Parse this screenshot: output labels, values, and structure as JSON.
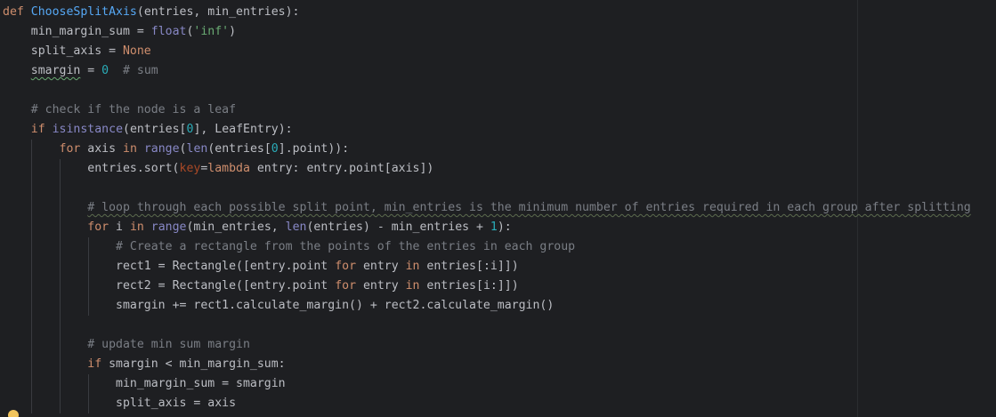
{
  "code": {
    "l1_def": "def",
    "l1_fn": "ChooseSplitAxis",
    "l1_rest": "(entries, min_entries):",
    "l2_a": "min_margin_sum = ",
    "l2_float": "float",
    "l2_p1": "(",
    "l2_str": "'inf'",
    "l2_p2": ")",
    "l3_a": "split_axis = ",
    "l3_none": "None",
    "l4_var": "smargin",
    "l4_a": " = ",
    "l4_num": "0",
    "l4_cm": "  # sum",
    "l6_cm": "# check if the node is a leaf",
    "l7_if": "if",
    "l7_isinstance": "isinstance",
    "l7_a": "(entries[",
    "l7_num": "0",
    "l7_b": "], LeafEntry):",
    "l8_for": "for",
    "l8_a": " axis ",
    "l8_in": "in",
    "l8_range": "range",
    "l8_p": "(",
    "l8_len": "len",
    "l8_b": "(entries[",
    "l8_num": "0",
    "l8_c": "].point)):",
    "l9_a": "entries.sort(",
    "l9_key": "key",
    "l9_eq": "=",
    "l9_lambda": "lambda",
    "l9_b": " entry: entry.point[axis])",
    "l11_cm": "# loop through each possible split point, min_entries is the minimum number of entries required in each group after splitting",
    "l12_for": "for",
    "l12_a": " i ",
    "l12_in": "in",
    "l12_range": "range",
    "l12_b": "(min_entries, ",
    "l12_len": "len",
    "l12_c": "(entries) - min_entries + ",
    "l12_num": "1",
    "l12_d": "):",
    "l13_cm": "# Create a rectangle from the points of the entries in each group",
    "l14_a": "rect1 = Rectangle([entry.point ",
    "l14_for": "for",
    "l14_b": " entry ",
    "l14_in": "in",
    "l14_c": " entries[:i]])",
    "l15_a": "rect2 = Rectangle([entry.point ",
    "l15_for": "for",
    "l15_b": " entry ",
    "l15_in": "in",
    "l15_c": " entries[i:]])",
    "l16_a": "smargin += rect1.calculate_margin() + rect2.calculate_margin()",
    "l18_cm": "# update min sum margin",
    "l19_if": "if",
    "l19_a": " smargin < min_margin_sum:",
    "l20_a": "min_margin_sum = smargin",
    "l21_a": "split_axis = axis"
  },
  "icons": {
    "intention": "lightbulb-icon"
  },
  "colors": {
    "background": "#1e1f22",
    "text": "#bcbec4",
    "keyword": "#cf8e6d",
    "function": "#56a8f5",
    "builtin": "#8888c6",
    "number": "#2aacb8",
    "string": "#6aab73",
    "comment": "#7a7e85",
    "kwarg": "#aa4926"
  }
}
